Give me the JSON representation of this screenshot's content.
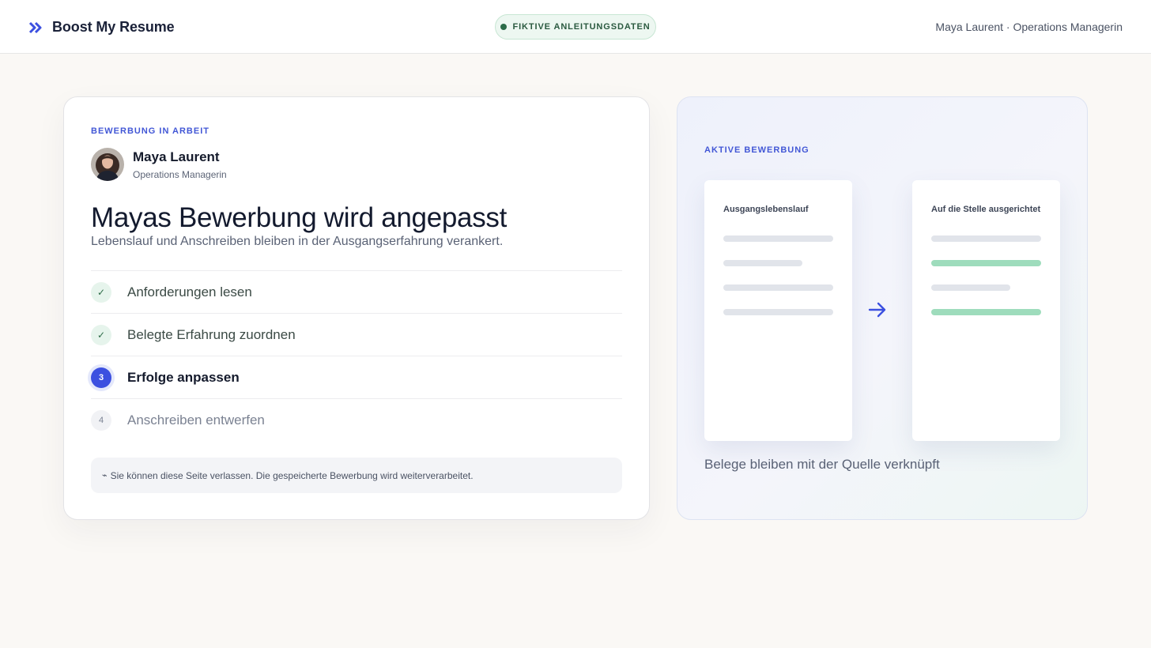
{
  "header": {
    "brand_name": "Boost My Resume",
    "brand_icon": "double-chevron-right-icon",
    "badge_label": "FIKTIVE ANLEITUNGSDATEN",
    "user_summary": "Maya Laurent · Operations Managerin"
  },
  "application": {
    "eyebrow": "BEWERBUNG IN ARBEIT",
    "candidate_name": "Maya Laurent",
    "candidate_role": "Operations Managerin",
    "headline": "Mayas Bewerbung wird angepasst",
    "subline": "Lebenslauf und Anschreiben bleiben in der Ausgangserfahrung verankert.",
    "steps": [
      {
        "marker": "✓",
        "label": "Anforderungen lesen",
        "status": "done"
      },
      {
        "marker": "✓",
        "label": "Belegte Erfahrung zuordnen",
        "status": "done"
      },
      {
        "marker": "3",
        "label": "Erfolge anpassen",
        "status": "current"
      },
      {
        "marker": "4",
        "label": "Anschreiben entwerfen",
        "status": "pending"
      }
    ],
    "notice_icon": "⌁",
    "notice": "Sie können diese Seite verlassen. Die gespeicherte Bewerbung wird weiterverarbeitet."
  },
  "preview": {
    "eyebrow": "AKTIVE BEWERBUNG",
    "source_title": "Ausgangslebenslauf",
    "target_title": "Auf die Stelle ausgerichtet",
    "caption": "Belege bleiben mit der Quelle verknüpft"
  },
  "colors": {
    "accent": "#3c50e0",
    "success": "#2d6b47",
    "highlight_line": "#9edcbc",
    "background": "#faf8f5"
  }
}
